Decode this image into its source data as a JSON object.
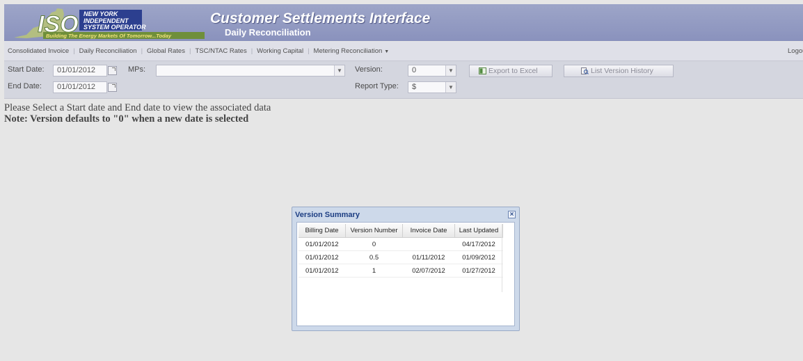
{
  "header": {
    "org_line1": "NEW YORK",
    "org_line2": "INDEPENDENT",
    "org_line3": "SYSTEM OPERATOR",
    "logo_letters": "ISO",
    "tagline": "Building The Energy Markets Of Tomorrow...Today",
    "title": "Customer Settlements Interface",
    "subtitle": "Daily Reconciliation"
  },
  "nav": {
    "items": [
      {
        "label": "Consolidated Invoice"
      },
      {
        "label": "Daily Reconciliation"
      },
      {
        "label": "Global Rates"
      },
      {
        "label": "TSC/NTAC Rates"
      },
      {
        "label": "Working Capital"
      },
      {
        "label": "Metering Reconciliation"
      }
    ],
    "logout_label": "Logout"
  },
  "toolbar": {
    "start_date_label": "Start Date:",
    "start_date_value": "01/01/2012",
    "end_date_label": "End Date:",
    "end_date_value": "01/01/2012",
    "mps_label": "MPs:",
    "mps_value": "",
    "version_label": "Version:",
    "version_value": "0",
    "report_type_label": "Report Type:",
    "report_type_value": "$",
    "export_label": "Export to Excel",
    "history_label": "List Version History"
  },
  "messages": {
    "instruction": "Please Select a Start date and End date to view the associated data",
    "note": "Note: Version defaults to \"0\" when a new date is selected"
  },
  "dialog": {
    "title": "Version Summary",
    "columns": [
      "Billing Date",
      "Version Number",
      "Invoice Date",
      "Last Updated"
    ],
    "rows": [
      [
        "01/01/2012",
        "0",
        "",
        "04/17/2012"
      ],
      [
        "01/01/2012",
        "0.5",
        "01/11/2012",
        "01/09/2012"
      ],
      [
        "01/01/2012",
        "1",
        "02/07/2012",
        "01/27/2012"
      ]
    ]
  },
  "colors": {
    "header_bg": "#9199c2",
    "dialog_title": "#1c3d82",
    "logo_green": "#7a9a3a",
    "logo_blue": "#2c3f8f"
  }
}
